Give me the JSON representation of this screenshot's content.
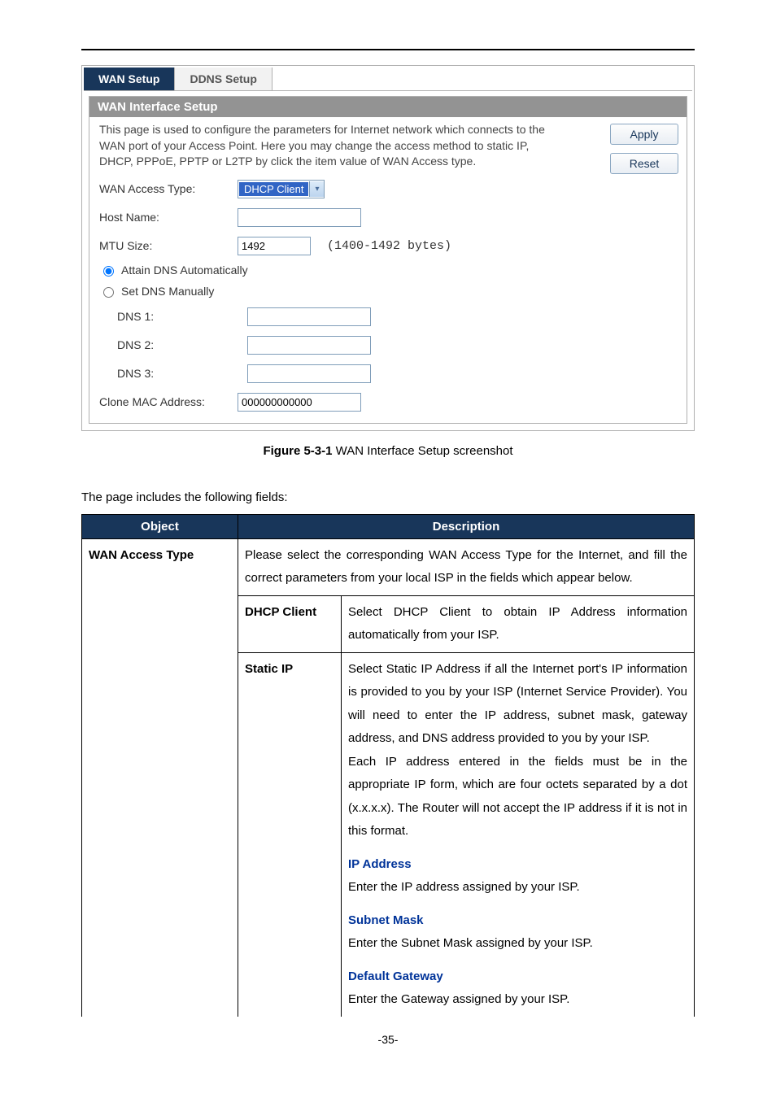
{
  "tabs": {
    "wan": "WAN Setup",
    "ddns": "DDNS Setup"
  },
  "panel": {
    "title": "WAN Interface Setup",
    "description": "This page is used to configure the parameters for Internet network which connects to the WAN port of your Access Point. Here you may change the access method to static IP, DHCP, PPPoE, PPTP or L2TP by click the item value of WAN Access type.",
    "buttons": {
      "apply": "Apply",
      "reset": "Reset"
    },
    "fields": {
      "wanAccessTypeLabel": "WAN Access Type:",
      "wanAccessTypeValue": "DHCP Client",
      "hostNameLabel": "Host Name:",
      "hostNameValue": "",
      "mtuLabel": "MTU Size:",
      "mtuValue": "1492",
      "mtuHint": "(1400-1492 bytes)",
      "dnsAutoLabel": "Attain DNS Automatically",
      "dnsManualLabel": "Set DNS Manually",
      "dns1Label": "DNS 1:",
      "dns2Label": "DNS 2:",
      "dns3Label": "DNS 3:",
      "cloneMacLabel": "Clone MAC Address:",
      "cloneMacValue": "000000000000"
    }
  },
  "caption": {
    "bold": "Figure 5-3-1",
    "rest": " WAN Interface Setup screenshot"
  },
  "introLine": "The page includes the following fields:",
  "table": {
    "head": {
      "object": "Object",
      "description": "Description"
    },
    "row1": {
      "object": "WAN Access Type",
      "desc": "Please select the corresponding WAN Access Type for the Internet, and fill the correct parameters from your local ISP in the fields which appear below."
    },
    "row2": {
      "left": "DHCP Client",
      "right": "Select DHCP Client to obtain IP Address information automatically from your ISP."
    },
    "row3": {
      "left": "Static IP",
      "rightMain": "Select Static IP Address if all the Internet port's IP information is provided to you by your ISP (Internet Service Provider). You will need to enter the IP address, subnet mask, gateway address, and DNS address provided to you by your ISP.\nEach IP address entered in the fields must be in the appropriate IP form, which are four octets separated by a dot (x.x.x.x). The Router will not accept the IP address if it is not in this format.",
      "ipAddrHead": "IP Address",
      "ipAddrText": "Enter the IP address assigned by your ISP.",
      "subnetHead": "Subnet Mask",
      "subnetText": "Enter the Subnet Mask assigned by your ISP.",
      "gwHead": "Default Gateway",
      "gwText": "Enter the Gateway assigned by your ISP."
    }
  },
  "pageNumber": "-35-"
}
